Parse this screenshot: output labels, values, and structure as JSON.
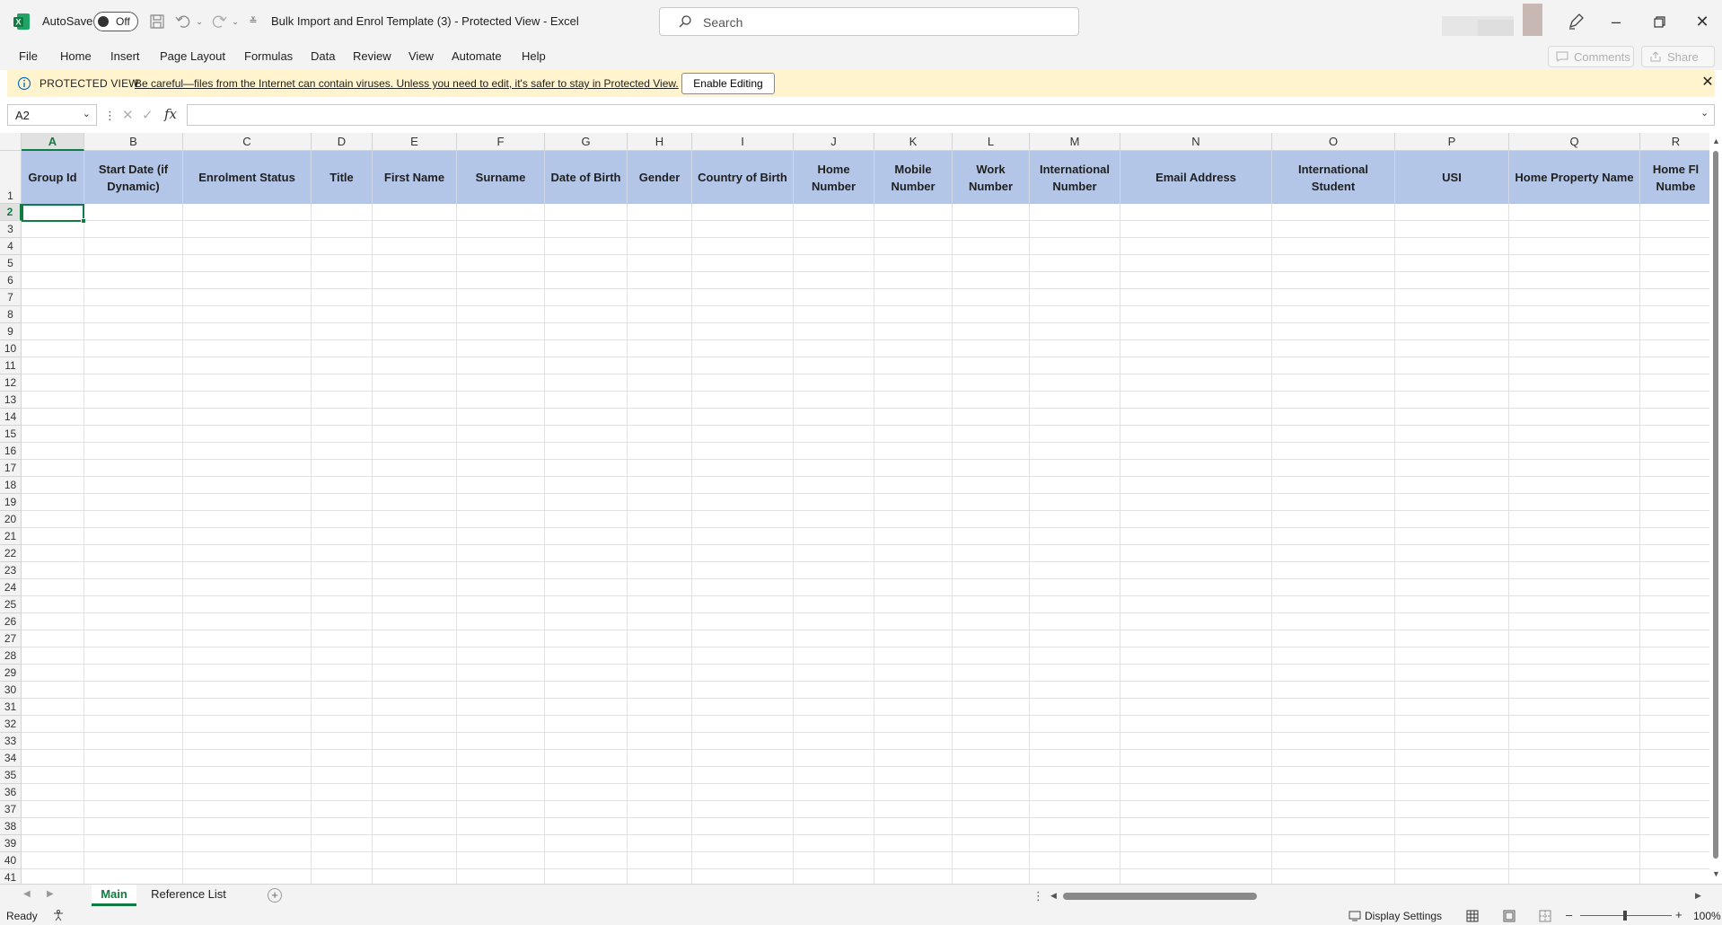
{
  "titlebar": {
    "autosave_label": "AutoSave",
    "autosave_state": "Off",
    "document_title": "Bulk Import and Enrol Template (3)  -  Protected View  -  Excel",
    "search_placeholder": "Search"
  },
  "ribbon": {
    "tabs": [
      "File",
      "Home",
      "Insert",
      "Page Layout",
      "Formulas",
      "Data",
      "Review",
      "View",
      "Automate",
      "Help"
    ],
    "comments_label": "Comments",
    "share_label": "Share"
  },
  "protected_view": {
    "title": "PROTECTED VIEW",
    "message": "Be careful—files from the Internet can contain viruses. Unless you need to edit, it's safer to stay in Protected View.",
    "button": "Enable Editing"
  },
  "formula_bar": {
    "name_box": "A2",
    "fx": "fx",
    "value": ""
  },
  "sheet": {
    "columns": [
      "A",
      "B",
      "C",
      "D",
      "E",
      "F",
      "G",
      "H",
      "I",
      "J",
      "K",
      "L",
      "M",
      "N",
      "O",
      "P",
      "Q",
      "R"
    ],
    "selected_column": "A",
    "selected_row": 2,
    "header_row": [
      "Group Id",
      "Start Date (if\nDynamic)",
      "Enrolment Status",
      "Title",
      "First Name",
      "Surname",
      "Date of Birth",
      "Gender",
      "Country of Birth",
      "Home\nNumber",
      "Mobile\nNumber",
      "Work\nNumber",
      "International\nNumber",
      "Email Address",
      "International\nStudent",
      "USI",
      "Home Property Name",
      "Home Fl\nNumbe"
    ],
    "row_count": 41,
    "header_fill": "#b4c6e7",
    "accent": "#107c41"
  },
  "tabs": {
    "sheets": [
      "Main",
      "Reference List"
    ],
    "active": "Main"
  },
  "status": {
    "ready": "Ready",
    "display_settings": "Display Settings",
    "zoom": "100%"
  }
}
